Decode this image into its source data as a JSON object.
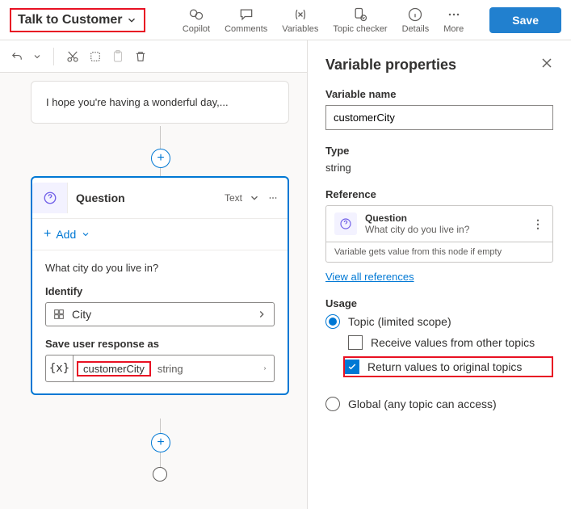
{
  "topbar": {
    "topic_name": "Talk to Customer",
    "actions": {
      "copilot": "Copilot",
      "comments": "Comments",
      "variables": "Variables",
      "topic_checker": "Topic checker",
      "details": "Details",
      "more": "More"
    },
    "save": "Save"
  },
  "canvas": {
    "message_preview": "I hope you're having a wonderful day,...",
    "question": {
      "title": "Question",
      "type_label": "Text",
      "add_label": "Add",
      "text": "What city do you live in?",
      "identify_label": "Identify",
      "identify_value": "City",
      "save_label": "Save user response as",
      "variable_name": "customerCity",
      "variable_type": "string"
    }
  },
  "panel": {
    "title": "Variable properties",
    "var_name_label": "Variable name",
    "var_name_value": "customerCity",
    "type_label": "Type",
    "type_value": "string",
    "reference_label": "Reference",
    "reference": {
      "title": "Question",
      "subtitle": "What city do you live in?",
      "note": "Variable gets value from this node if empty"
    },
    "view_all": "View all references",
    "usage_label": "Usage",
    "usage": {
      "topic_scope": "Topic (limited scope)",
      "receive": "Receive values from other topics",
      "return": "Return values to original topics",
      "global": "Global (any topic can access)"
    }
  }
}
